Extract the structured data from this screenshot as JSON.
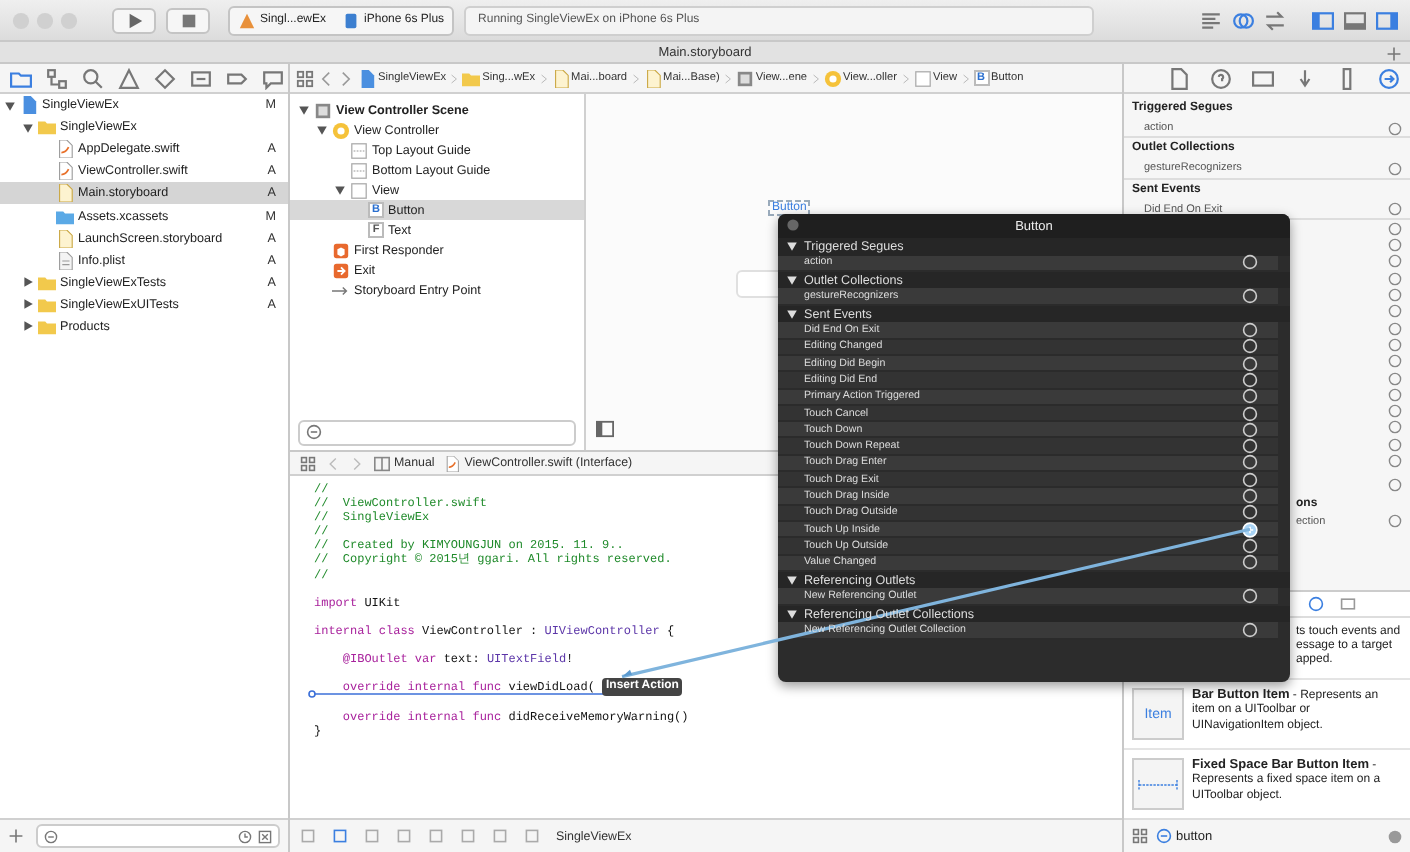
{
  "toolbar": {
    "scheme": "Singl...ewEx",
    "device": "iPhone 6s Plus",
    "status": "Running SingleViewEx on iPhone 6s Plus",
    "editor_modes": [
      {
        "kind": "standard",
        "selected": false
      },
      {
        "kind": "assistant",
        "selected": true
      },
      {
        "kind": "version",
        "selected": false
      }
    ],
    "panels": [
      {
        "kind": "navigator",
        "on": true
      },
      {
        "kind": "debug",
        "on": false
      },
      {
        "kind": "utilities",
        "on": true
      }
    ]
  },
  "tab_title": "Main.storyboard",
  "navigator": {
    "tabs": [
      {
        "kind": "project",
        "selected": true
      },
      {
        "kind": "symbols",
        "selected": false
      },
      {
        "kind": "search",
        "selected": false
      },
      {
        "kind": "issues",
        "selected": false
      },
      {
        "kind": "tests",
        "selected": false
      },
      {
        "kind": "debug",
        "selected": false
      },
      {
        "kind": "breakpoints",
        "selected": false
      },
      {
        "kind": "reports",
        "selected": false
      }
    ],
    "items": [
      {
        "name": "SingleViewEx",
        "kind": "project",
        "status": "M",
        "expanded": true,
        "selected": false,
        "children": [
          {
            "name": "SingleViewEx",
            "kind": "folder",
            "expanded": true,
            "selected": false,
            "children": [
              {
                "name": "AppDelegate.swift",
                "kind": "swift",
                "status": "A",
                "selected": false
              },
              {
                "name": "ViewController.swift",
                "kind": "swift",
                "status": "A",
                "selected": false
              },
              {
                "name": "Main.storyboard",
                "kind": "storyboard",
                "status": "A",
                "selected": true
              },
              {
                "name": "Assets.xcassets",
                "kind": "assets",
                "status": "M",
                "selected": false
              },
              {
                "name": "LaunchScreen.storyboard",
                "kind": "storyboard",
                "status": "A",
                "selected": false
              },
              {
                "name": "Info.plist",
                "kind": "plist",
                "status": "A",
                "selected": false
              }
            ]
          },
          {
            "name": "SingleViewExTests",
            "kind": "folder",
            "status": "A",
            "expanded": false,
            "selected": false
          },
          {
            "name": "SingleViewExUITests",
            "kind": "folder",
            "status": "A",
            "expanded": false,
            "selected": false
          },
          {
            "name": "Products",
            "kind": "folder",
            "expanded": false,
            "selected": false
          }
        ]
      }
    ]
  },
  "jump_bar": [
    {
      "label": "SingleViewEx",
      "kind": "project"
    },
    {
      "label": "Sing...wEx",
      "kind": "folder"
    },
    {
      "label": "Mai...board",
      "kind": "storyboard"
    },
    {
      "label": "Mai...Base)",
      "kind": "storyboard"
    },
    {
      "label": "View...ene",
      "kind": "scene"
    },
    {
      "label": "View...oller",
      "kind": "controller"
    },
    {
      "label": "View",
      "kind": "view"
    },
    {
      "label": "Button",
      "kind": "button",
      "glyph": "B"
    }
  ],
  "outline": [
    {
      "name": "View Controller Scene",
      "kind": "scene",
      "expanded": true,
      "selected": false,
      "children": [
        {
          "name": "View Controller",
          "kind": "controller",
          "expanded": true,
          "selected": false,
          "children": [
            {
              "name": "Top Layout Guide",
              "kind": "guide",
              "selected": false
            },
            {
              "name": "Bottom Layout Guide",
              "kind": "guide",
              "selected": false
            },
            {
              "name": "View",
              "kind": "view",
              "expanded": true,
              "selected": false,
              "children": [
                {
                  "name": "Button",
                  "kind": "button",
                  "glyph": "B",
                  "selected": true
                },
                {
                  "name": "Text",
                  "kind": "textfield",
                  "glyph": "F",
                  "selected": false
                }
              ]
            }
          ]
        },
        {
          "name": "First Responder",
          "kind": "responder",
          "selected": false
        },
        {
          "name": "Exit",
          "kind": "exit",
          "selected": false
        },
        {
          "name": "Storyboard Entry Point",
          "kind": "entry",
          "selected": false
        }
      ]
    }
  ],
  "canvas": {
    "button_label": "Button"
  },
  "assistant_bar": {
    "mode": "Manual",
    "file": "ViewController.swift (Interface)"
  },
  "code": [
    {
      "kind": "code",
      "segments": [
        {
          "text": "//",
          "kind": "comment"
        }
      ]
    },
    {
      "kind": "code",
      "segments": [
        {
          "text": "//  ViewController.swift",
          "kind": "comment"
        }
      ]
    },
    {
      "kind": "code",
      "segments": [
        {
          "text": "//  SingleViewEx",
          "kind": "comment"
        }
      ]
    },
    {
      "kind": "code",
      "segments": [
        {
          "text": "//",
          "kind": "comment"
        }
      ]
    },
    {
      "kind": "code",
      "segments": [
        {
          "text": "//  Created by KIMYOUNGJUN on 2015. 11. 9..",
          "kind": "comment"
        }
      ]
    },
    {
      "kind": "code",
      "segments": [
        {
          "text": "//  Copyright © 2015년 ggari. All rights reserved.",
          "kind": "comment"
        }
      ]
    },
    {
      "kind": "code",
      "segments": [
        {
          "text": "//",
          "kind": "comment"
        }
      ]
    },
    {
      "kind": "blank"
    },
    {
      "kind": "code",
      "segments": [
        {
          "text": "import",
          "kind": "keyword"
        },
        {
          "text": " UIKit",
          "kind": "plain"
        }
      ]
    },
    {
      "kind": "blank"
    },
    {
      "kind": "code",
      "segments": [
        {
          "text": "internal class",
          "kind": "keyword"
        },
        {
          "text": " ViewController : ",
          "kind": "plain"
        },
        {
          "text": "UIViewController",
          "kind": "type"
        },
        {
          "text": " {",
          "kind": "plain"
        }
      ]
    },
    {
      "kind": "blank"
    },
    {
      "kind": "code",
      "segments": [
        {
          "text": "    @IBOutlet var",
          "kind": "keyword"
        },
        {
          "text": " text: ",
          "kind": "plain"
        },
        {
          "text": "UITextField",
          "kind": "type"
        },
        {
          "text": "!",
          "kind": "plain"
        }
      ]
    },
    {
      "kind": "blank"
    },
    {
      "kind": "code",
      "insertion_marker": true,
      "segments": [
        {
          "text": "    override internal func",
          "kind": "keyword"
        },
        {
          "text": " viewDidLoad(",
          "kind": "plain"
        }
      ]
    },
    {
      "kind": "blank"
    },
    {
      "kind": "code",
      "segments": [
        {
          "text": "    override internal func",
          "kind": "keyword"
        },
        {
          "text": " didReceiveMemoryWarning()",
          "kind": "plain"
        }
      ]
    },
    {
      "kind": "code",
      "segments": [
        {
          "text": "}",
          "kind": "plain"
        }
      ]
    }
  ],
  "tooltip": "Insert Action",
  "debug_bar": {
    "target": "SingleViewEx"
  },
  "inspector": {
    "tabs": [
      {
        "kind": "file",
        "selected": false
      },
      {
        "kind": "help",
        "selected": false
      },
      {
        "kind": "identity",
        "selected": false
      },
      {
        "kind": "attributes",
        "selected": false
      },
      {
        "kind": "size",
        "selected": false
      },
      {
        "kind": "connections",
        "selected": true
      }
    ],
    "sections": [
      {
        "title": "Triggered Segues",
        "items": [
          "action"
        ]
      },
      {
        "title": "Outlet Collections",
        "items": [
          "gestureRecognizers"
        ]
      },
      {
        "title": "Sent Events",
        "items": [
          "Did End On Exit"
        ]
      }
    ],
    "partial_rows": [
      {
        "kind": "item"
      },
      {
        "kind": "header",
        "text": "ons"
      },
      {
        "kind": "item",
        "text": "ection"
      }
    ]
  },
  "library": {
    "partial_description": "ts touch events and essage to a target apped.",
    "items": [
      {
        "thumb": "Item",
        "kind": "bar-button",
        "description": "**Bar Button Item** - Represents an item on a UIToolbar or UINavigationItem object."
      },
      {
        "kind": "fixed-space",
        "description": "**Fixed Space Bar Button Item** - Represents a fixed space item on a UIToolbar object."
      }
    ],
    "filter": "button"
  },
  "popup": {
    "title": "Button",
    "sections": [
      {
        "title": "Triggered Segues",
        "expanded": true,
        "items": [
          {
            "label": "action",
            "connected": false
          }
        ]
      },
      {
        "title": "Outlet Collections",
        "expanded": true,
        "items": [
          {
            "label": "gestureRecognizers",
            "connected": false
          }
        ]
      },
      {
        "title": "Sent Events",
        "expanded": true,
        "items": [
          {
            "label": "Did End On Exit",
            "connected": false
          },
          {
            "label": "Editing Changed",
            "connected": false
          },
          {
            "label": "Editing Did Begin",
            "connected": false
          },
          {
            "label": "Editing Did End",
            "connected": false
          },
          {
            "label": "Primary Action Triggered",
            "connected": false
          },
          {
            "label": "Touch Cancel",
            "connected": false
          },
          {
            "label": "Touch Down",
            "connected": false
          },
          {
            "label": "Touch Down Repeat",
            "connected": false
          },
          {
            "label": "Touch Drag Enter",
            "connected": false
          },
          {
            "label": "Touch Drag Exit",
            "connected": false
          },
          {
            "label": "Touch Drag Inside",
            "connected": false
          },
          {
            "label": "Touch Drag Outside",
            "connected": false
          },
          {
            "label": "Touch Up Inside",
            "connected": true
          },
          {
            "label": "Touch Up Outside",
            "connected": false
          },
          {
            "label": "Value Changed",
            "connected": false
          }
        ]
      },
      {
        "title": "Referencing Outlets",
        "expanded": true,
        "items": [
          {
            "label": "New Referencing Outlet",
            "connected": false
          }
        ]
      },
      {
        "title": "Referencing Outlet Collections",
        "expanded": true,
        "items": [
          {
            "label": "New Referencing Outlet Collection",
            "connected": false
          }
        ]
      }
    ]
  }
}
